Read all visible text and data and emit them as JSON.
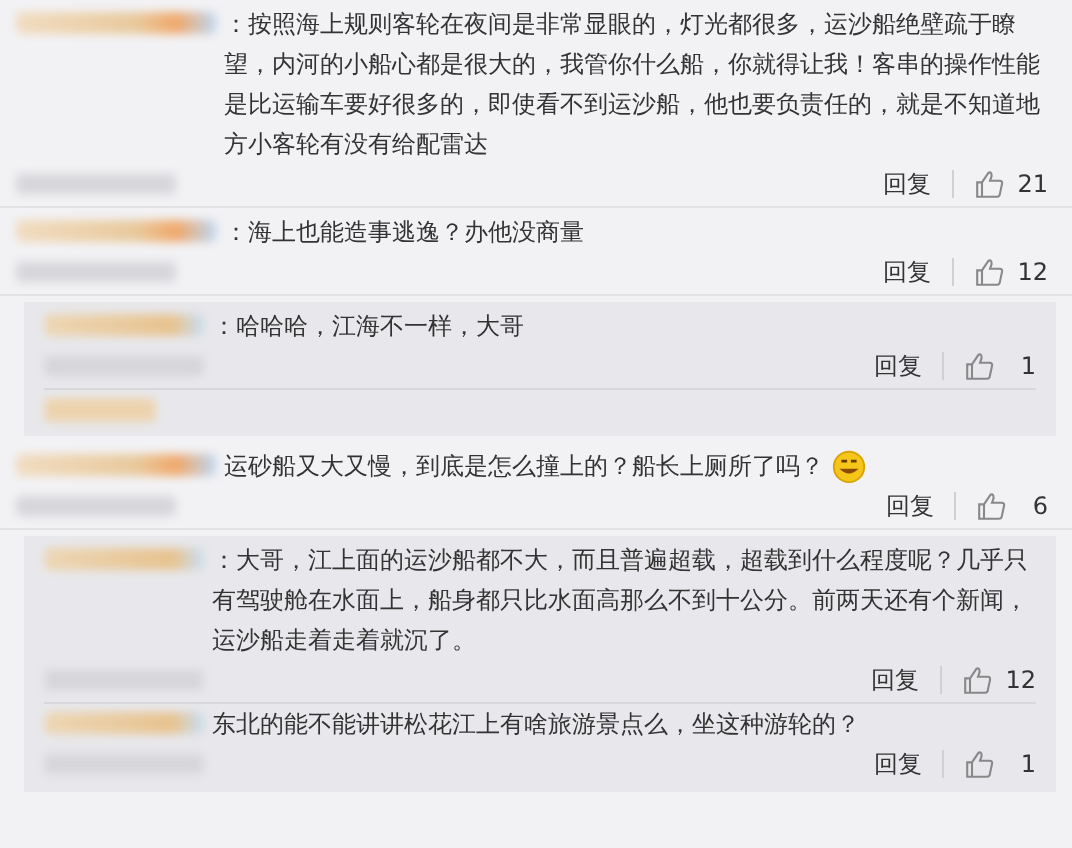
{
  "comments": [
    {
      "kind": "comment",
      "text": "：按照海上规则客轮在夜间是非常显眼的，灯光都很多，运沙船绝壁疏于瞭望，内河的小船心都是很大的，我管你什么船，你就得让我！客串的操作性能是比运输车要好很多的，即使看不到运沙船，他也要负责任的，就是不知道地方小客轮有没有给配雷达",
      "reply": "回复",
      "likes": "21"
    },
    {
      "kind": "comment",
      "text": "：海上也能造事逃逸？办他没商量",
      "reply": "回复",
      "likes": "12"
    },
    {
      "kind": "replies",
      "more": true,
      "replies": [
        {
          "text": "：哈哈哈，江海不一样，大哥",
          "reply": "回复",
          "likes": "1"
        }
      ]
    },
    {
      "kind": "comment",
      "text": "运砂船又大又慢，到底是怎么撞上的？船长上厕所了吗？",
      "emoji": true,
      "reply": "回复",
      "likes": "6"
    },
    {
      "kind": "replies",
      "more": false,
      "replies": [
        {
          "text": "：大哥，江上面的运沙船都不大，而且普遍超载，超载到什么程度呢？几乎只有驾驶舱在水面上，船身都只比水面高那么不到十公分。前两天还有个新闻，运沙船走着走着就沉了。",
          "reply": "回复",
          "likes": "12"
        },
        {
          "text": "东北的能不能讲讲松花江上有啥旅游景点么，坐这种游轮的？",
          "reply": "回复",
          "likes": "1"
        }
      ]
    }
  ]
}
